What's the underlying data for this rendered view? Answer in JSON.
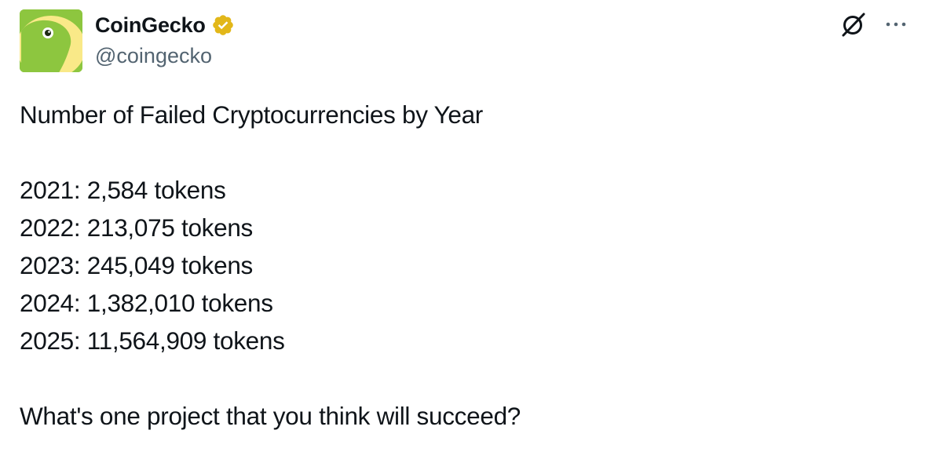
{
  "author": {
    "name": "CoinGecko",
    "handle": "@coingecko",
    "verified": true,
    "avatar_icon": "coingecko-gecko-icon",
    "avatar_color": "#8dc63f",
    "badge_color": "#e2b719"
  },
  "actions": {
    "grok_icon": "grok-icon",
    "more_icon": "more-icon"
  },
  "tweet": {
    "title": "Number of Failed Cryptocurrencies by Year",
    "stats": [
      "2021: 2,584 tokens",
      "2022: 213,075 tokens",
      "2023: 245,049 tokens",
      "2024: 1,382,010 tokens",
      "2025: 11,564,909 tokens"
    ],
    "question": "What's one project that you think will succeed?"
  }
}
